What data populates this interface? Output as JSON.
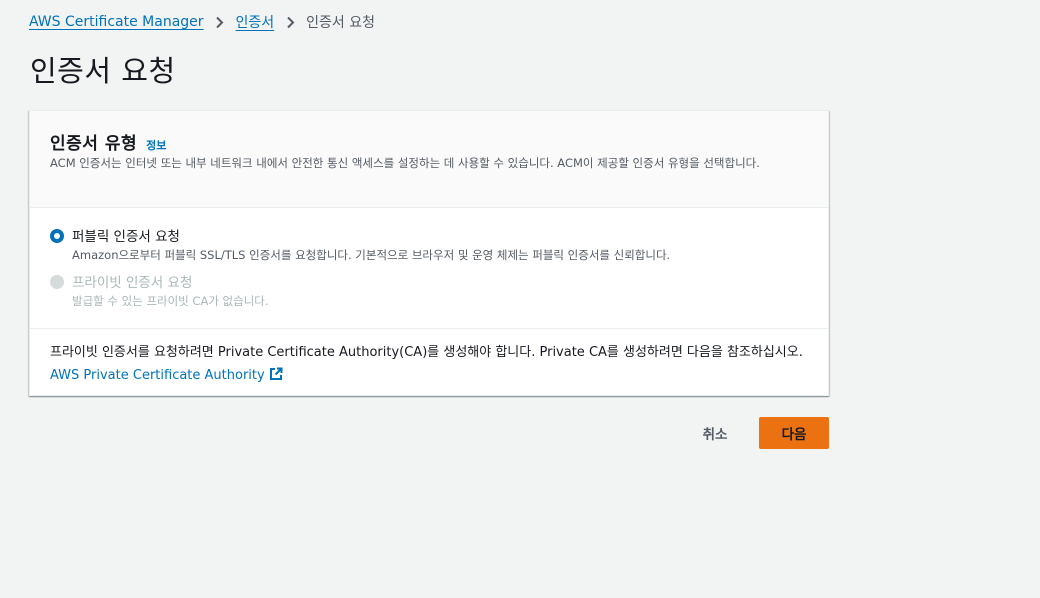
{
  "breadcrumb": {
    "items": [
      {
        "label": "AWS Certificate Manager"
      },
      {
        "label": "인증서"
      },
      {
        "label": "인증서 요청"
      }
    ]
  },
  "page": {
    "title": "인증서 요청"
  },
  "certificate_type": {
    "title": "인증서 유형",
    "info_label": "정보",
    "description": "ACM 인증서는 인터넷 또는 내부 네트워크 내에서 안전한 통신 액세스를 설정하는 데 사용할 수 있습니다. ACM이 제공할 인증서 유형을 선택합니다.",
    "options": [
      {
        "label": "퍼블릭 인증서 요청",
        "description": "Amazon으로부터 퍼블릭 SSL/TLS 인증서를 요청합니다. 기본적으로 브라우저 및 운영 체제는 퍼블릭 인증서를 신뢰합니다.",
        "selected": true,
        "disabled": false
      },
      {
        "label": "프라이빗 인증서 요청",
        "description": "발급할 수 있는 프라이빗 CA가 없습니다.",
        "selected": false,
        "disabled": true
      }
    ],
    "footer_text": "프라이빗 인증서를 요청하려면 Private Certificate Authority(CA)를 생성해야 합니다. Private CA를 생성하려면 다음을 참조하십시오.",
    "footer_link": "AWS Private Certificate Authority"
  },
  "actions": {
    "cancel_label": "취소",
    "next_label": "다음"
  },
  "colors": {
    "link": "#0073bb",
    "primary_button": "#ec7211",
    "background": "#f2f3f3"
  },
  "icons": {
    "breadcrumb_separator": "chevron-right-icon",
    "external_link": "external-link-icon"
  }
}
